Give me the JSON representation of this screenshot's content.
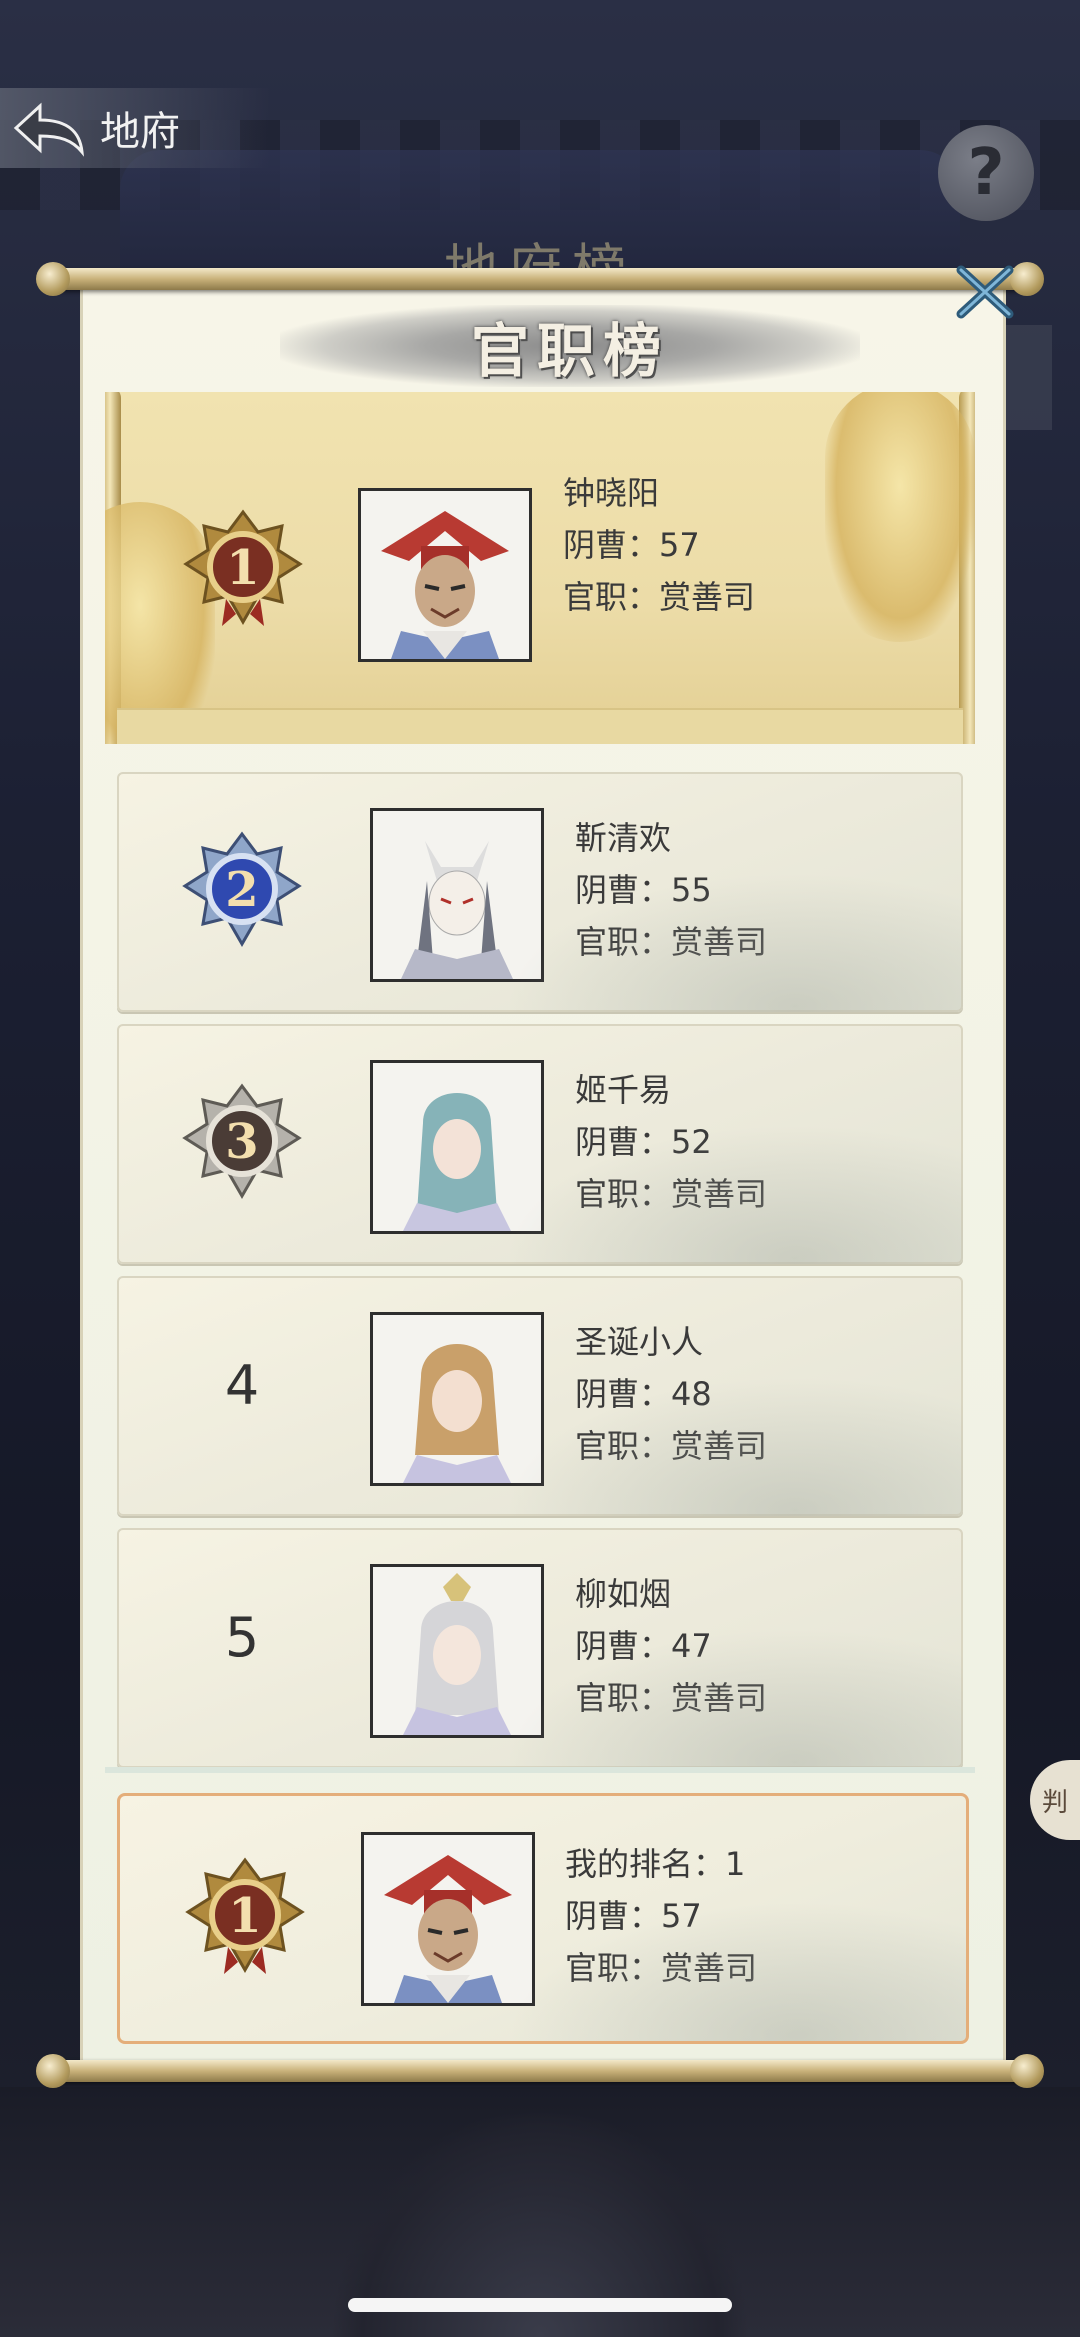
{
  "header": {
    "back_label": "地府",
    "back_icon": "back-arrow-icon",
    "help_icon": "question-icon"
  },
  "background": {
    "title": "地府榜"
  },
  "panel": {
    "title": "官职榜",
    "stat_prefix": "阴曹：",
    "rank_prefix": "官职：",
    "entries": [
      {
        "rank": 1,
        "name": "钟晓阳",
        "stat": "阴曹：57",
        "rank_title": "官职：赏善司",
        "badge": "gold"
      },
      {
        "rank": 2,
        "name": "靳清欢",
        "stat": "阴曹：55",
        "rank_title": "官职：赏善司",
        "badge": "blue"
      },
      {
        "rank": 3,
        "name": "姬千易",
        "stat": "阴曹：52",
        "rank_title": "官职：赏善司",
        "badge": "silver"
      },
      {
        "rank": 4,
        "name": "圣诞小人",
        "stat": "阴曹：48",
        "rank_title": "官职：赏善司",
        "badge": "none",
        "rank_label": "4"
      },
      {
        "rank": 5,
        "name": "柳如烟",
        "stat": "阴曹：47",
        "rank_title": "官职：赏善司",
        "badge": "none",
        "rank_label": "5"
      }
    ],
    "mine": {
      "label": "我的排名：1",
      "stat": "阴曹：57",
      "rank_title": "官职：赏善司"
    }
  },
  "side_stamp": "判",
  "colors": {
    "gold": "#c9a24a",
    "blue": "#2f49b0",
    "silver": "#8a8a8a",
    "panel": "#f3f2e6",
    "mine_border": "#e4ae7a"
  }
}
